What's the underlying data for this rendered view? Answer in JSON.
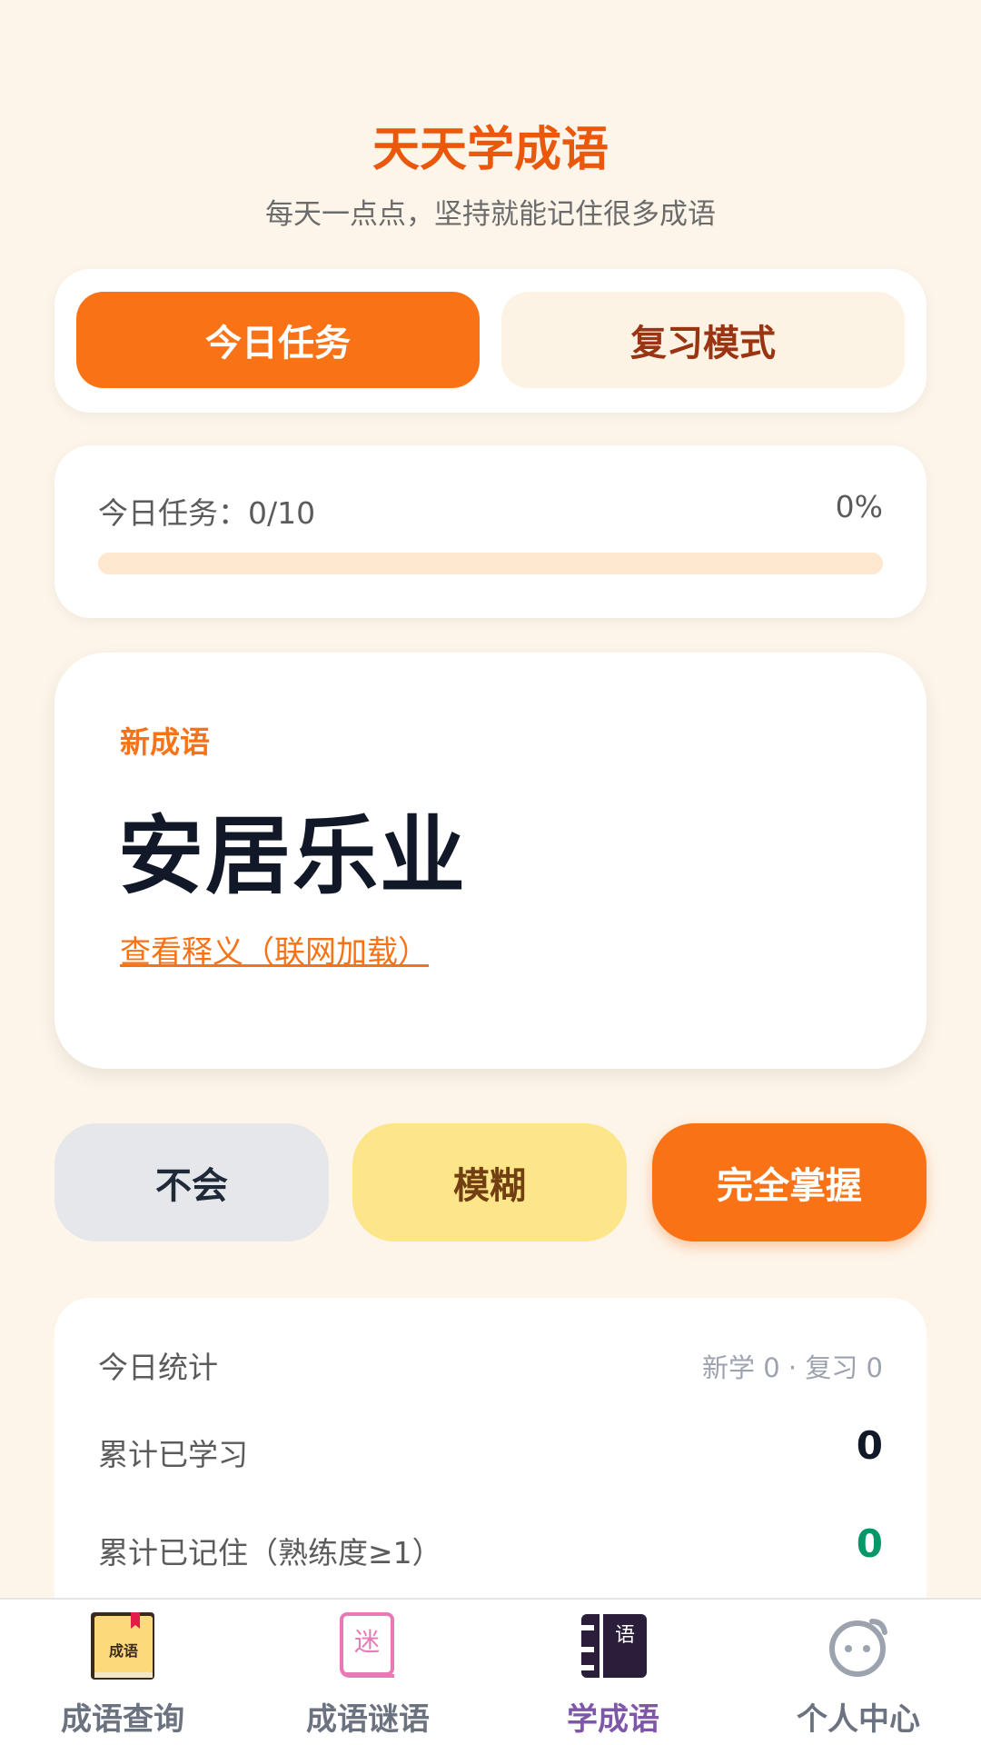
{
  "app": {
    "title": "天天学成语",
    "subtitle": "每天一点点，坚持就能记住很多成语"
  },
  "mode_tabs": {
    "today_label": "今日任务",
    "review_label": "复习模式",
    "active": "today"
  },
  "progress": {
    "label": "今日任务：0/10",
    "percent_text": "0%",
    "fraction": 0
  },
  "word_card": {
    "tag": "新成语",
    "idiom": "安居乐业",
    "link_text": "查看释义（联网加载）"
  },
  "rating_buttons": {
    "unknown": "不会",
    "fuzzy": "模糊",
    "mastered": "完全掌握"
  },
  "stats": {
    "title": "今日统计",
    "summary": "新学 0 · 复习 0",
    "total_learned_label": "累计已学习",
    "total_learned_value": "0",
    "total_memorized_label": "累计已记住（熟练度≥1）",
    "total_memorized_value": "0"
  },
  "bottom_nav": {
    "items": [
      {
        "label": "成语查询",
        "icon": "idiom-book-icon"
      },
      {
        "label": "成语谜语",
        "icon": "riddle-book-icon"
      },
      {
        "label": "学成语",
        "icon": "learn-idiom-icon"
      },
      {
        "label": "个人中心",
        "icon": "user-face-icon"
      }
    ],
    "active_index": 2,
    "icon_glyphs": {
      "idiom_book": "成语",
      "riddle_book": "迷",
      "learn_idiom": "语"
    }
  },
  "colors": {
    "accent": "#f97316",
    "title": "#ea580c",
    "background": "#fdf5ea",
    "success": "#059669",
    "nav_active": "#7e57a8"
  }
}
